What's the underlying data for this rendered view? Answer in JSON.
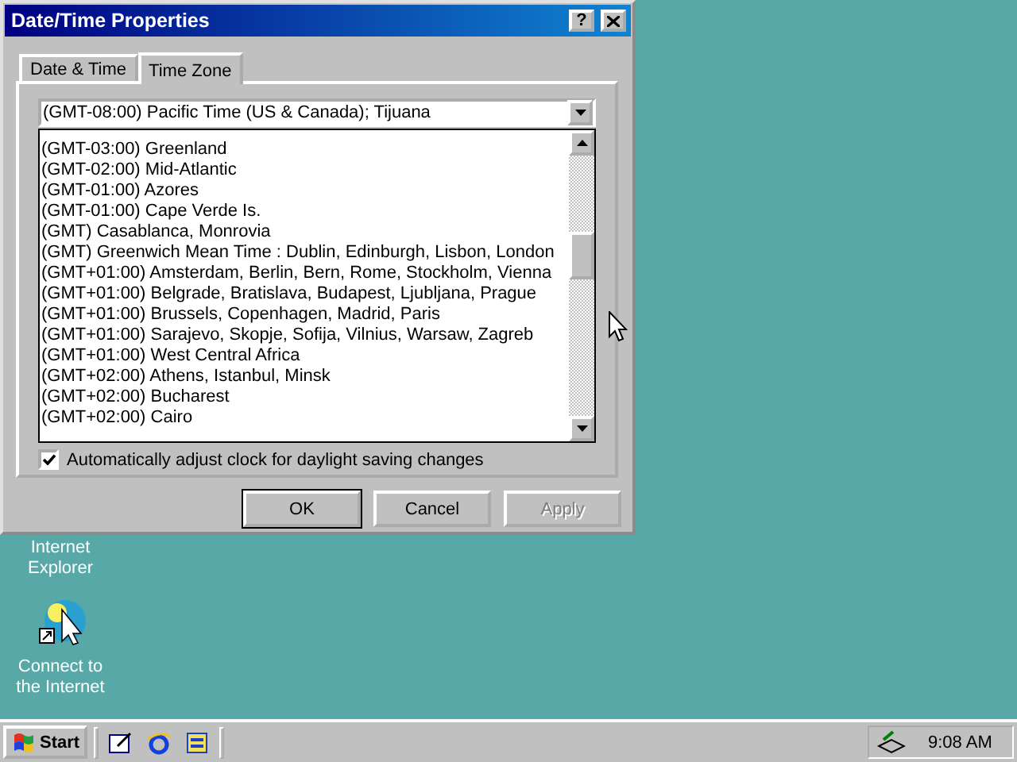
{
  "window": {
    "title": "Date/Time Properties",
    "help_button": "?"
  },
  "tabs": [
    {
      "label": "Date & Time",
      "selected": false
    },
    {
      "label": "Time Zone",
      "selected": true
    }
  ],
  "timezone_combo": {
    "value": "(GMT-08:00) Pacific Time (US & Canada); Tijuana"
  },
  "timezone_list": [
    {
      "label": "(GMT-03:00) Greenland",
      "selected": false
    },
    {
      "label": "(GMT-02:00) Mid-Atlantic",
      "selected": false
    },
    {
      "label": "(GMT-01:00) Azores",
      "selected": false
    },
    {
      "label": "(GMT-01:00) Cape Verde Is.",
      "selected": false
    },
    {
      "label": "(GMT) Casablanca, Monrovia",
      "selected": false
    },
    {
      "label": "(GMT) Greenwich Mean Time : Dublin, Edinburgh, Lisbon, London",
      "selected": false
    },
    {
      "label": "(GMT+01:00) Amsterdam, Berlin, Bern, Rome, Stockholm, Vienna",
      "selected": false
    },
    {
      "label": "(GMT+01:00) Belgrade, Bratislava, Budapest, Ljubljana, Prague",
      "selected": false
    },
    {
      "label": "(GMT+01:00) Brussels, Copenhagen, Madrid, Paris",
      "selected": false
    },
    {
      "label": "(GMT+01:00) Sarajevo, Skopje, Sofija, Vilnius, Warsaw, Zagreb",
      "selected": false
    },
    {
      "label": "(GMT+01:00) West Central Africa",
      "selected": false
    },
    {
      "label": "(GMT+02:00) Athens, Istanbul, Minsk",
      "selected": false
    },
    {
      "label": "(GMT+02:00) Bucharest",
      "selected": false
    },
    {
      "label": "(GMT+02:00) Cairo",
      "selected": false
    }
  ],
  "daylight_saving": {
    "label": "Automatically adjust clock for daylight saving changes",
    "checked": true
  },
  "buttons": [
    {
      "label": "OK",
      "disabled": false,
      "default": true
    },
    {
      "label": "Cancel",
      "disabled": false,
      "default": false
    },
    {
      "label": "Apply",
      "disabled": true,
      "default": false
    }
  ],
  "desktop_icons": [
    {
      "label": "Internet Explorer",
      "kind": "hidden"
    },
    {
      "label": "Connect to the Internet",
      "kind": "connect"
    }
  ],
  "taskbar": {
    "start_label": "Start",
    "clock": "9:08 AM"
  }
}
